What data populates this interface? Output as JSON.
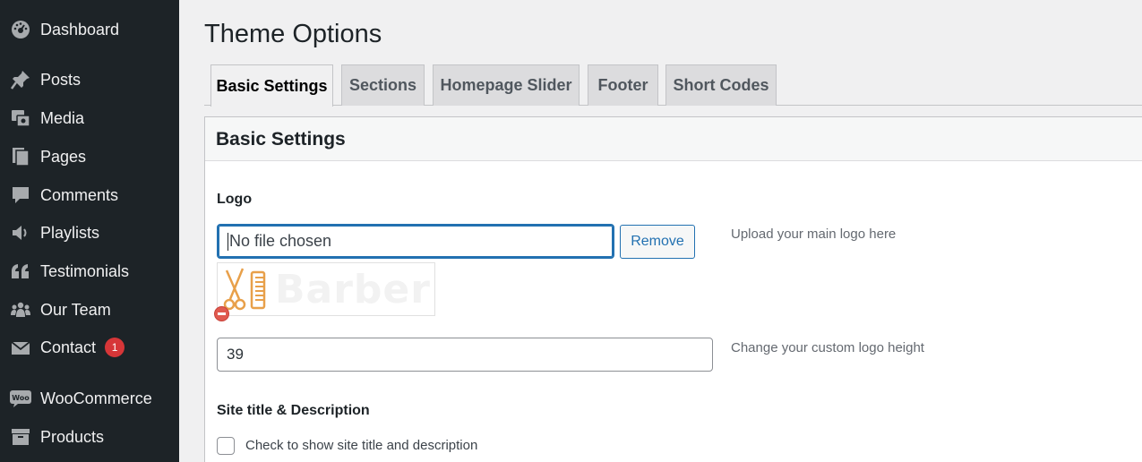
{
  "sidebar": {
    "items": [
      {
        "label": "Dashboard",
        "icon": "dashboard-icon"
      },
      {
        "label": "Posts",
        "icon": "pin-icon"
      },
      {
        "label": "Media",
        "icon": "media-icon"
      },
      {
        "label": "Pages",
        "icon": "pages-icon"
      },
      {
        "label": "Comments",
        "icon": "comment-icon"
      },
      {
        "label": "Playlists",
        "icon": "speaker-icon"
      },
      {
        "label": "Testimonials",
        "icon": "quote-icon"
      },
      {
        "label": "Our Team",
        "icon": "groups-icon"
      },
      {
        "label": "Contact",
        "icon": "mail-icon",
        "badge": "1"
      },
      {
        "label": "WooCommerce",
        "icon": "woo-icon"
      },
      {
        "label": "Products",
        "icon": "archive-icon"
      }
    ]
  },
  "header": {
    "title": "Theme Options"
  },
  "tabs": [
    {
      "label": "Basic Settings",
      "active": true
    },
    {
      "label": "Sections"
    },
    {
      "label": "Homepage Slider"
    },
    {
      "label": "Footer"
    },
    {
      "label": "Short Codes"
    }
  ],
  "panel": {
    "title": "Basic Settings",
    "logo": {
      "label": "Logo",
      "file_placeholder": "No file chosen",
      "remove_label": "Remove",
      "help": "Upload your main logo here",
      "preview_text": "Barber"
    },
    "logo_height": {
      "value": "39",
      "help": "Change your custom logo height"
    },
    "site_title": {
      "label": "Site title & Description",
      "checkbox_label": "Check to show site title and description"
    }
  },
  "colors": {
    "sidebar_bg": "#1d2327",
    "accent": "#2271b1",
    "badge": "#d63638",
    "logo_accent": "#e8a04a"
  }
}
